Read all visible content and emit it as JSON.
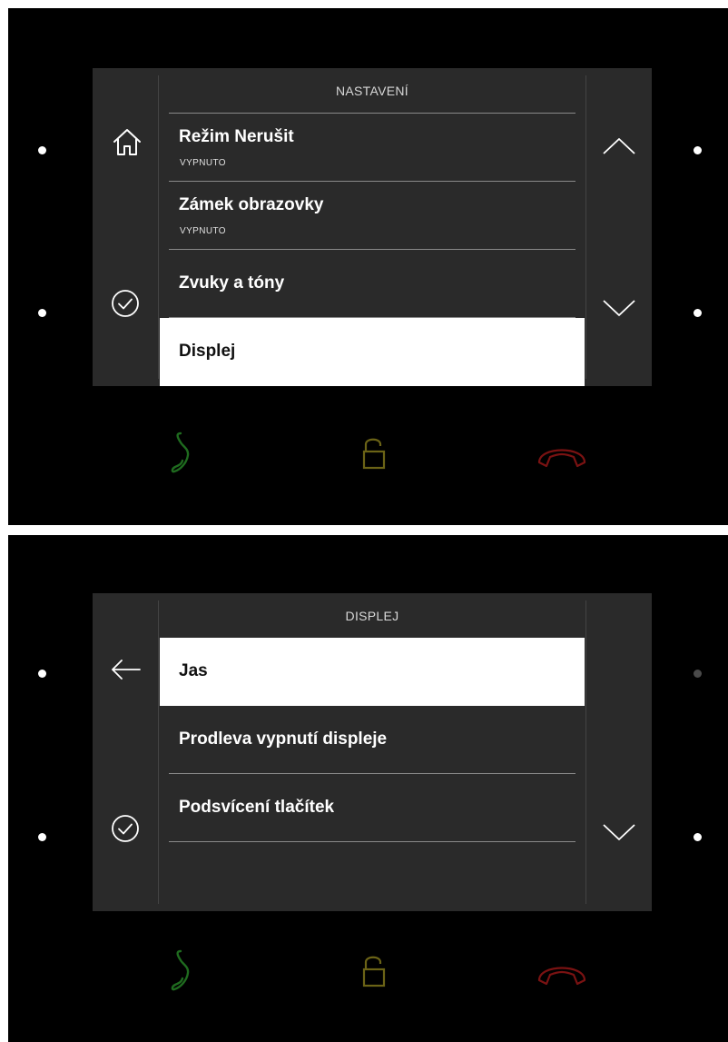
{
  "screens": [
    {
      "title": "NASTAVENÍ",
      "left_icons": [
        "home-icon",
        "check-circle-icon"
      ],
      "right_icons": [
        "chevron-up-icon",
        "chevron-down-icon"
      ],
      "items": [
        {
          "label": "Režim Nerušit",
          "sub": "VYPNUTO",
          "selected": false
        },
        {
          "label": "Zámek obrazovky",
          "sub": "VYPNUTO",
          "selected": false
        },
        {
          "label": "Zvuky a tóny",
          "sub": "",
          "selected": false
        },
        {
          "label": "Displej",
          "sub": "",
          "selected": true
        }
      ]
    },
    {
      "title": "DISPLEJ",
      "left_icons": [
        "back-arrow-icon",
        "check-circle-icon"
      ],
      "right_icons": [
        "chevron-down-icon"
      ],
      "items": [
        {
          "label": "Jas",
          "sub": "",
          "selected": true
        },
        {
          "label": "Prodleva vypnutí displeje",
          "sub": "",
          "selected": false
        },
        {
          "label": "Podsvícení tlačítek",
          "sub": "",
          "selected": false
        }
      ]
    }
  ],
  "hardware_buttons": [
    {
      "name": "call-icon",
      "color": "#1f6b1f"
    },
    {
      "name": "unlock-icon",
      "color": "#6b6316"
    },
    {
      "name": "hang-up-icon",
      "color": "#7a1212"
    }
  ],
  "colors": {
    "frame": "#000000",
    "screen": "#2a2a2a",
    "selected_bg": "#ffffff",
    "divider": "#8a8a8a"
  }
}
